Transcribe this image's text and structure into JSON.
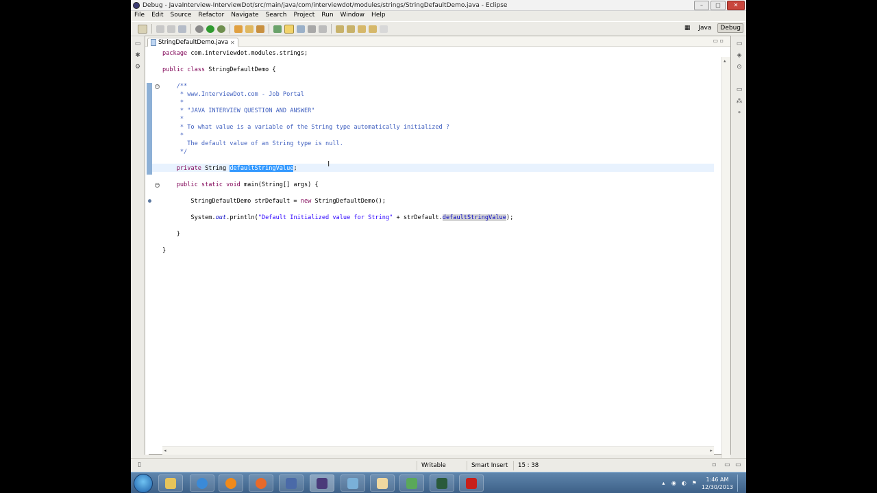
{
  "window": {
    "title": "Debug - JavaInterview-InterviewDot/src/main/java/com/interviewdot/modules/strings/StringDefaultDemo.java - Eclipse",
    "controls": {
      "minimize": "–",
      "maximize": "□",
      "close": "✕"
    }
  },
  "menu": [
    "File",
    "Edit",
    "Source",
    "Refactor",
    "Navigate",
    "Search",
    "Project",
    "Run",
    "Window",
    "Help"
  ],
  "perspectives": {
    "java": "Java",
    "debug": "Debug"
  },
  "editor": {
    "tab_label": "StringDefaultDemo.java",
    "tab_close": "✕",
    "code": {
      "l1_kw": "package",
      "l1_rest": " com.interviewdot.modules.strings;",
      "l2_kw": "public class",
      "l2_rest": " StringDefaultDemo {",
      "c1": "    /**",
      "c2": "     * www.InterviewDot.com - Job Portal",
      "c3": "     *",
      "c4": "     * \"JAVA INTERVIEW QUESTION AND ANSWER\"",
      "c5": "     *",
      "c6": "     * To what value is a variable of the String type automatically initialized ?",
      "c7": "     *",
      "c8": "       The default value of an String type is null.",
      "c9": "     */",
      "f_kw": "    private",
      "f_type": " String ",
      "f_name": "defaultStringValue",
      "f_end": ";",
      "m_kw": "    public static void",
      "m_rest": " main(String[] args) {",
      "s1_a": "        StringDefaultDemo strDefault = ",
      "s1_kw": "new",
      "s1_b": " StringDefaultDemo();",
      "s2_a": "        System.",
      "s2_out": "out",
      "s2_b": ".println(",
      "s2_str": "\"Default Initialized value for String\"",
      "s2_c": " + strDefault.",
      "s2_fld": "defaultStringValue",
      "s2_d": ");",
      "close_method": "    }",
      "close_class": "}"
    }
  },
  "status": {
    "writable": "Writable",
    "insert_mode": "Smart Insert",
    "position": "15 : 38"
  },
  "clock": {
    "time": "1:46 AM",
    "date": "12/30/2013"
  },
  "colors": {
    "keyword": "#7f0055",
    "comment": "#3f5fbf",
    "string": "#2a00ff",
    "field": "#0000c0",
    "selection": "#3399ff"
  }
}
